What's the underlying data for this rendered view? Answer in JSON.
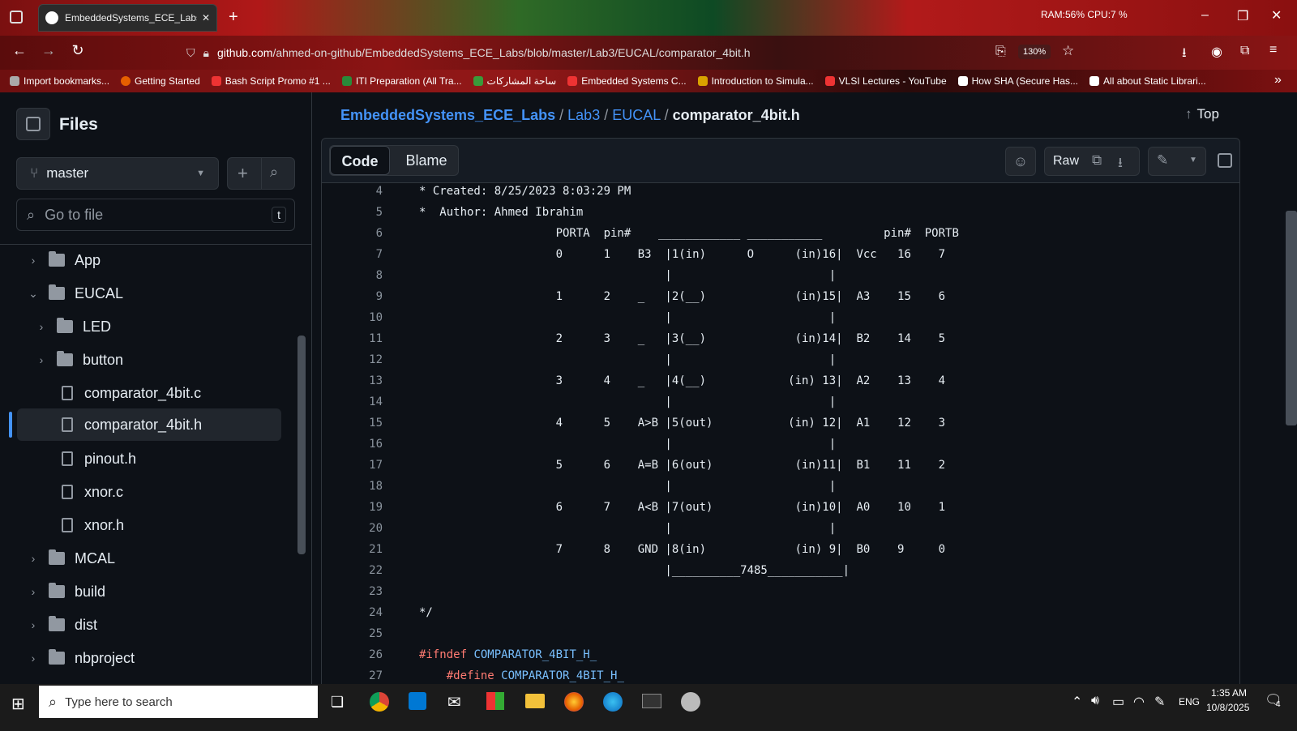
{
  "browser": {
    "tab_title": "EmbeddedSystems_ECE_Labs/L",
    "sysinfo": "RAM:56%  CPU:7 %",
    "url_domain": "github.com",
    "url_path": "/ahmed-on-github/EmbeddedSystems_ECE_Labs/blob/master/Lab3/EUCAL/comparator_4bit.h",
    "zoom": "130%",
    "bookmarks": [
      "Import bookmarks...",
      "Getting Started",
      "Bash Script Promo #1 ...",
      "ITI Preparation (All Tra...",
      "ساحة المشاركات",
      "Embedded Systems C...",
      "Introduction to Simula...",
      "VLSI Lectures - YouTube",
      "How SHA (Secure Has...",
      "All about Static Librari..."
    ]
  },
  "sidebar": {
    "title": "Files",
    "branch": "master",
    "search_placeholder": "Go to file",
    "shortcut": "t",
    "tree": [
      {
        "label": "App",
        "type": "folder",
        "depth": 0,
        "expanded": false
      },
      {
        "label": "EUCAL",
        "type": "folder",
        "depth": 0,
        "expanded": true
      },
      {
        "label": "LED",
        "type": "folder",
        "depth": 1,
        "expanded": false
      },
      {
        "label": "button",
        "type": "folder",
        "depth": 1,
        "expanded": false
      },
      {
        "label": "comparator_4bit.c",
        "type": "file",
        "depth": 1
      },
      {
        "label": "comparator_4bit.h",
        "type": "file",
        "depth": 1,
        "selected": true
      },
      {
        "label": "pinout.h",
        "type": "file",
        "depth": 1
      },
      {
        "label": "xnor.c",
        "type": "file",
        "depth": 1
      },
      {
        "label": "xnor.h",
        "type": "file",
        "depth": 1
      },
      {
        "label": "MCAL",
        "type": "folder",
        "depth": 0,
        "expanded": false
      },
      {
        "label": "build",
        "type": "folder",
        "depth": 0,
        "expanded": false
      },
      {
        "label": "dist",
        "type": "folder",
        "depth": 0,
        "expanded": false
      },
      {
        "label": "nbproject",
        "type": "folder",
        "depth": 0,
        "expanded": false
      }
    ]
  },
  "breadcrumb": {
    "repo": "EmbeddedSystems_ECE_Labs",
    "dir1": "Lab3",
    "dir2": "EUCAL",
    "file": "comparator_4bit.h",
    "sep": "/",
    "top": "Top"
  },
  "toolbar": {
    "tab_code": "Code",
    "tab_blame": "Blame",
    "raw": "Raw"
  },
  "code": [
    {
      "n": "4",
      "t": "* Created: 8/25/2023 8:03:29 PM",
      "k": "c"
    },
    {
      "n": "5",
      "t": "*  Author: Ahmed Ibrahim",
      "k": "c"
    },
    {
      "n": "6",
      "t": "                    PORTA  pin#    ____________ ___________         pin#  PORTB",
      "k": "c"
    },
    {
      "n": "7",
      "t": "                    0      1    B3  |1(in)      O      (in)16|  Vcc   16    7",
      "k": "c"
    },
    {
      "n": "8",
      "t": "                                    |                       |",
      "k": "c"
    },
    {
      "n": "9",
      "t": "                    1      2    _   |2(__)             (in)15|  A3    15    6",
      "k": "c"
    },
    {
      "n": "10",
      "t": "                                    |                       |",
      "k": "c"
    },
    {
      "n": "11",
      "t": "                    2      3    _   |3(__)             (in)14|  B2    14    5",
      "k": "c"
    },
    {
      "n": "12",
      "t": "                                    |                       |",
      "k": "c"
    },
    {
      "n": "13",
      "t": "                    3      4    _   |4(__)            (in) 13|  A2    13    4",
      "k": "c"
    },
    {
      "n": "14",
      "t": "                                    |                       |",
      "k": "c"
    },
    {
      "n": "15",
      "t": "                    4      5    A>B |5(out)           (in) 12|  A1    12    3",
      "k": "c"
    },
    {
      "n": "16",
      "t": "                                    |                       |",
      "k": "c"
    },
    {
      "n": "17",
      "t": "                    5      6    A=B |6(out)            (in)11|  B1    11    2",
      "k": "c"
    },
    {
      "n": "18",
      "t": "                                    |                       |",
      "k": "c"
    },
    {
      "n": "19",
      "t": "                    6      7    A<B |7(out)            (in)10|  A0    10    1",
      "k": "c"
    },
    {
      "n": "20",
      "t": "                                    |                       |",
      "k": "c"
    },
    {
      "n": "21",
      "t": "                    7      8    GND |8(in)             (in) 9|  B0    9     0",
      "k": "c"
    },
    {
      "n": "22",
      "t": "                                    |__________7485___________|",
      "k": "c"
    },
    {
      "n": "23",
      "t": "",
      "k": "c"
    },
    {
      "n": "24",
      "t": "*/",
      "k": "c"
    },
    {
      "n": "25",
      "t": "",
      "k": "c"
    },
    {
      "n": "26",
      "pp": "#ifndef",
      "mc": " COMPARATOR_4BIT_H_",
      "k": "pp",
      "indent": ""
    },
    {
      "n": "27",
      "pp": "#define",
      "mc": " COMPARATOR_4BIT_H_",
      "k": "pp",
      "indent": "    "
    }
  ],
  "taskbar": {
    "search_placeholder": "Type here to search",
    "lang": "ENG",
    "time": "1:35 AM",
    "date": "10/8/2025",
    "notif_count": "4"
  },
  "colors": {
    "accent_link": "#4493f8",
    "bg": "#0d1117",
    "preproc": "#ff7b72",
    "macro": "#79c0ff"
  }
}
